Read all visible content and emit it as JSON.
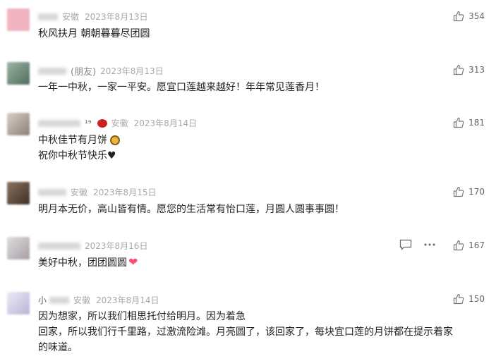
{
  "comments": [
    {
      "location": "安徽",
      "date": "2023年8月13日",
      "text": [
        "秋风扶月 朝朝暮暮尽团圆"
      ],
      "likes": "354",
      "avatar_color": "#f1b4c0"
    },
    {
      "friend_tag": "(朋友)",
      "date": "2023年8月13日",
      "text": [
        "一年一中秋，一家一平安。愿宜口莲越来越好！年年常见莲香月！"
      ],
      "likes": "313",
      "avatar_color": "#6f8f7d"
    },
    {
      "nick_suffix": "¹⁹",
      "location": "安徽",
      "date": "2023年8月14日",
      "text": [
        "中秋佳节有月饼",
        "祝你中秋节快乐♥"
      ],
      "likes": "181",
      "avatar_color": "#b3a59a"
    },
    {
      "location": "安徽",
      "date": "2023年8月15日",
      "text": [
        "明月本无价，高山皆有情。愿您的生活常有怡口莲，月圆人圆事事圆！"
      ],
      "likes": "170",
      "avatar_color": "#5a4a3e"
    },
    {
      "date": "2023年8月16日",
      "text": [
        "美好中秋，团团圆圆"
      ],
      "likes": "167",
      "avatar_color": "#c9c4c8"
    },
    {
      "nick_prefix": "小",
      "location": "安徽",
      "date": "2023年8月14日",
      "text": [
        "因为想家，所以我们相思托付给明月。因为着急",
        "回家，所以我们行千里路，过激流险滩。月亮圆了，该回家了，每块宜口莲的月饼都在提示着家",
        "的味道。"
      ],
      "likes": "150",
      "avatar_color": "#d9d6ee"
    }
  ],
  "colors": {
    "meta": "#a8a8a8",
    "text": "#222222",
    "like_icon": "#777777",
    "heart": "#ff4f75"
  },
  "icons": {
    "like": "thumbs-up-icon",
    "reply": "reply-icon",
    "more": "more-dots-icon"
  }
}
